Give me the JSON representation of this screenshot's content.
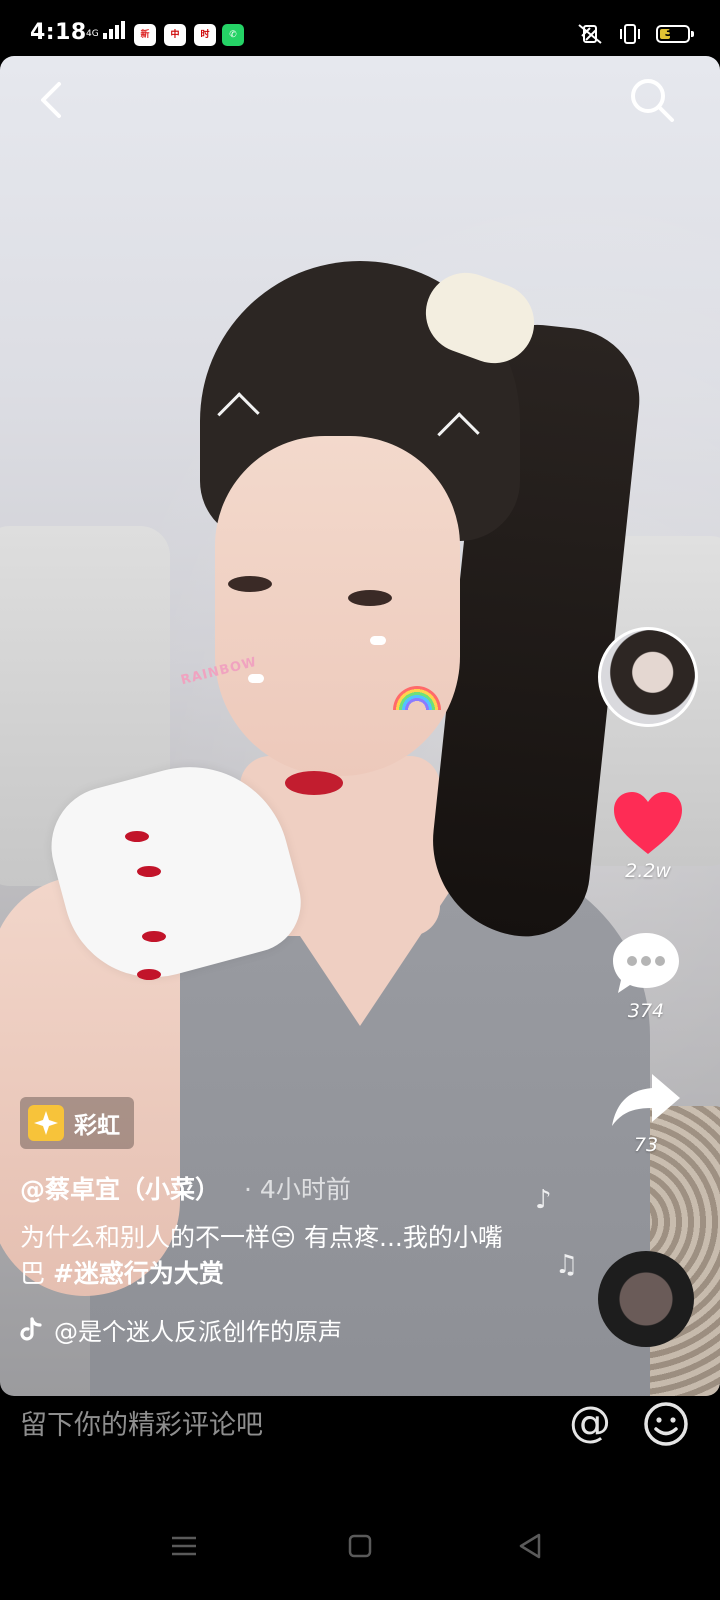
{
  "status_bar": {
    "time": "4:18",
    "network": "4G",
    "battery": "37",
    "battery_level": 0.37,
    "icons": [
      "signal-icon",
      "app-icon-news",
      "app-icon-news-2",
      "app-icon-news-3",
      "whatsapp-icon",
      "mute-vibrate-icon",
      "vibrate-icon",
      "battery-icon"
    ]
  },
  "video": {
    "effect_text": "RAINBOW",
    "tag_label": "彩虹",
    "author": "@蔡卓宜（小菜）",
    "time_ago": "· 4小时前",
    "caption_text": "为什么和别人的不一样😒 有点疼...我的小嘴巴 ",
    "hashtag": "#迷惑行为大赏",
    "music": "@是个迷人反派创作的原声"
  },
  "actions": {
    "likes": "2.2w",
    "comments": "374",
    "shares": "73"
  },
  "comment_bar": {
    "placeholder": "留下你的精彩评论吧",
    "at": "@"
  },
  "colors": {
    "like": "#fe2c55",
    "tag_icon": "#f7c33a",
    "background": "#000000"
  }
}
